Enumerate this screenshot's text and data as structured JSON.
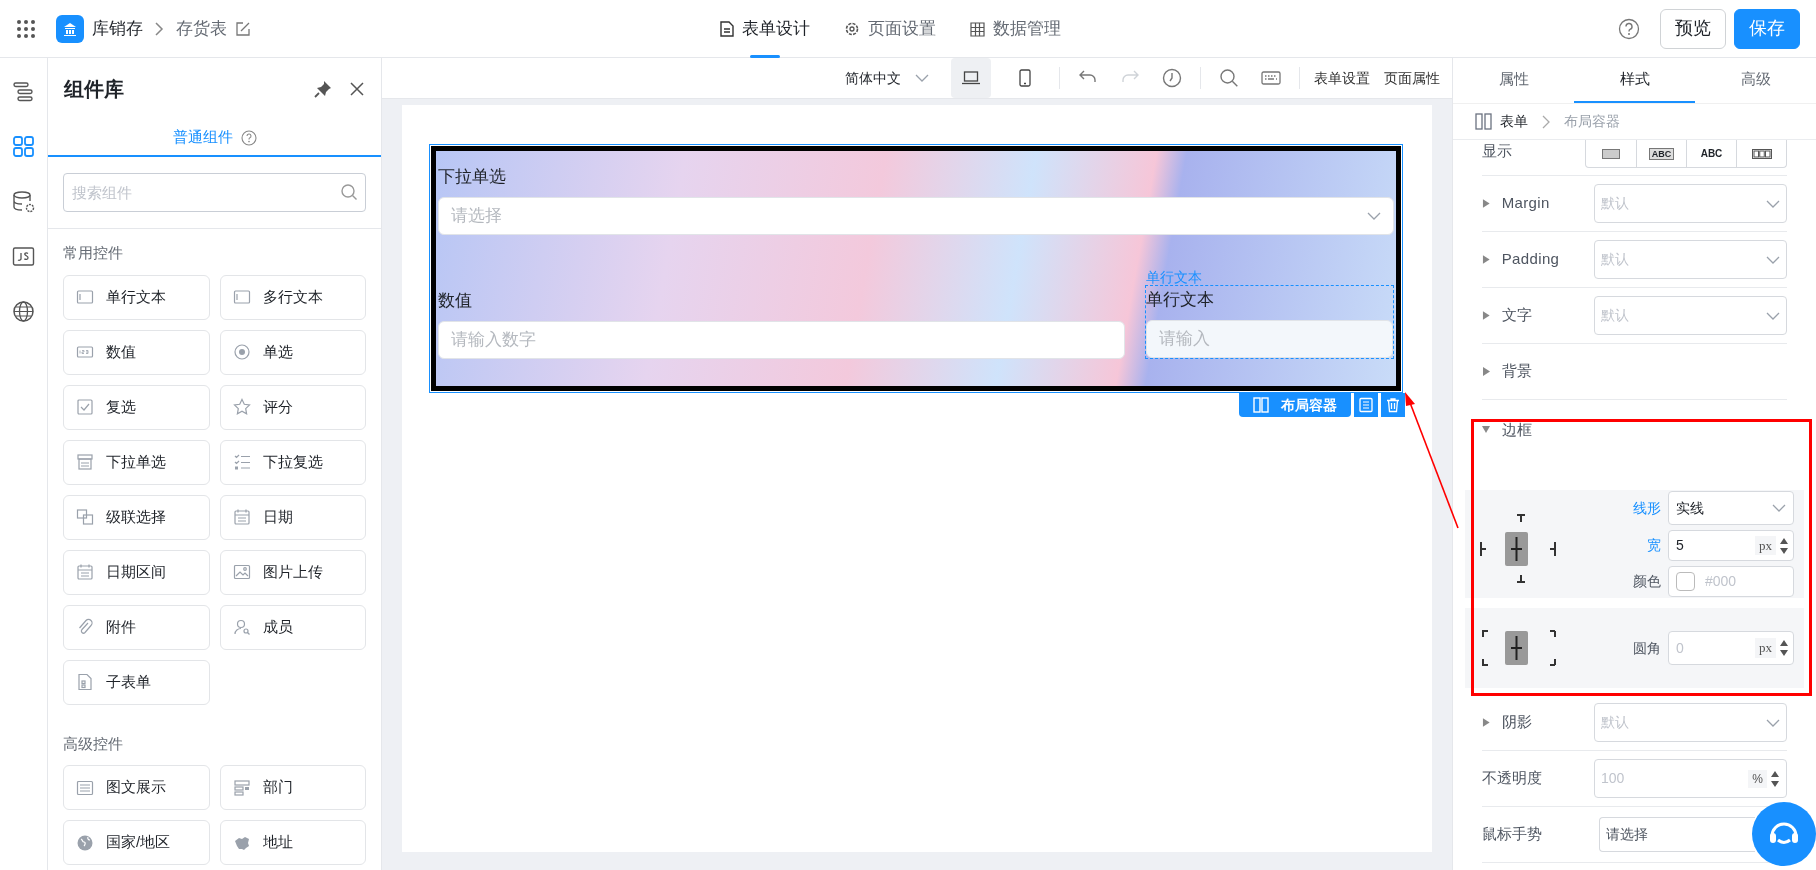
{
  "topbar": {
    "app_name": "库销存",
    "page_name": "存货表",
    "tabs": [
      {
        "label": "表单设计",
        "kind": "document",
        "selected": true
      },
      {
        "label": "页面设置",
        "kind": "gear",
        "selected": false
      },
      {
        "label": "数据管理",
        "kind": "table",
        "selected": false
      }
    ],
    "buttons": [
      {
        "label": "预览",
        "kind": "secondary"
      },
      {
        "label": "保存",
        "kind": "primary"
      }
    ]
  },
  "rail": [
    {
      "kind": "outline",
      "selected": false
    },
    {
      "kind": "components",
      "selected": true
    },
    {
      "kind": "database",
      "selected": false
    },
    {
      "kind": "js",
      "selected": false
    },
    {
      "kind": "globe",
      "selected": false
    }
  ],
  "component_panel": {
    "title": "组件库",
    "tab": "普通组件",
    "search_placeholder": "搜索组件",
    "groups": [
      {
        "title": "常用控件",
        "items": [
          {
            "label": "单行文本",
            "kind": "input"
          },
          {
            "label": "多行文本",
            "kind": "input"
          },
          {
            "label": "数值",
            "kind": "number"
          },
          {
            "label": "单选",
            "kind": "radio"
          },
          {
            "label": "复选",
            "kind": "checkbox"
          },
          {
            "label": "评分",
            "kind": "star"
          },
          {
            "label": "下拉单选",
            "kind": "select"
          },
          {
            "label": "下拉复选",
            "kind": "checklist"
          },
          {
            "label": "级联选择",
            "kind": "cascade"
          },
          {
            "label": "日期",
            "kind": "calendar"
          },
          {
            "label": "日期区间",
            "kind": "calendar"
          },
          {
            "label": "图片上传",
            "kind": "image"
          },
          {
            "label": "附件",
            "kind": "paperclip"
          },
          {
            "label": "成员",
            "kind": "user"
          },
          {
            "label": "子表单",
            "kind": "document"
          }
        ]
      },
      {
        "title": "高级控件",
        "items": [
          {
            "label": "图文展示",
            "kind": "lines"
          },
          {
            "label": "部门",
            "kind": "department"
          },
          {
            "label": "国家/地区",
            "kind": "globe"
          },
          {
            "label": "地址",
            "kind": "map"
          }
        ]
      }
    ]
  },
  "toolbar": {
    "language": "简体中文",
    "devices": [
      {
        "kind": "desktop",
        "selected": true
      },
      {
        "kind": "mobile",
        "selected": false
      }
    ],
    "actions": [
      {
        "kind": "undo",
        "disabled": false
      },
      {
        "kind": "redo",
        "disabled": true
      },
      {
        "kind": "history",
        "disabled": false
      },
      {
        "kind": "search",
        "disabled": false
      },
      {
        "kind": "keyboard",
        "disabled": false
      }
    ],
    "links": [
      "表单设置",
      "页面属性"
    ]
  },
  "canvas": {
    "rows": [
      [
        {
          "label": "下拉单选",
          "kind": "select",
          "placeholder": "请选择",
          "selected": false
        }
      ],
      [
        {
          "label": "数值",
          "kind": "input",
          "placeholder": "请输入数字",
          "selected": false
        },
        {
          "label": "单行文本",
          "kind": "input",
          "placeholder": "请输入",
          "selected": true,
          "hint": "单行文本"
        }
      ]
    ],
    "container_label": "布局容器"
  },
  "properties": {
    "tabs": [
      {
        "label": "属性",
        "selected": false
      },
      {
        "label": "样式",
        "selected": true
      },
      {
        "label": "高级",
        "selected": false
      }
    ],
    "breadcrumb": [
      "表单",
      "布局容器"
    ],
    "display": {
      "label": "显示",
      "options": [
        {
          "kind": "block",
          "selected": false
        },
        {
          "kind": "inline",
          "text": "ABC",
          "selected": false
        },
        {
          "kind": "text",
          "text": "ABC",
          "selected": false
        },
        {
          "kind": "flex",
          "selected": false
        }
      ]
    },
    "sections": [
      {
        "label": "Margin",
        "kind": "select",
        "placeholder": "默认",
        "expanded": false
      },
      {
        "label": "Padding",
        "kind": "select",
        "placeholder": "默认",
        "expanded": false
      },
      {
        "label": "文字",
        "kind": "select",
        "placeholder": "默认",
        "expanded": false
      },
      {
        "label": "背景",
        "kind": "plain",
        "expanded": false
      },
      {
        "label": "边框",
        "kind": "border",
        "expanded": true,
        "style_label": "线形",
        "style_value": "实线",
        "width_label": "宽",
        "width_value": "5",
        "width_unit": "px",
        "color_label": "颜色",
        "color_placeholder": "#000",
        "radius_label": "圆角",
        "radius_placeholder": "0",
        "radius_unit": "px"
      },
      {
        "label": "阴影",
        "kind": "select",
        "placeholder": "默认",
        "expanded": false
      },
      {
        "label": "不透明度",
        "kind": "number",
        "placeholder": "100",
        "unit": "%"
      },
      {
        "label": "鼠标手势",
        "kind": "value",
        "value": "请选择"
      }
    ]
  }
}
